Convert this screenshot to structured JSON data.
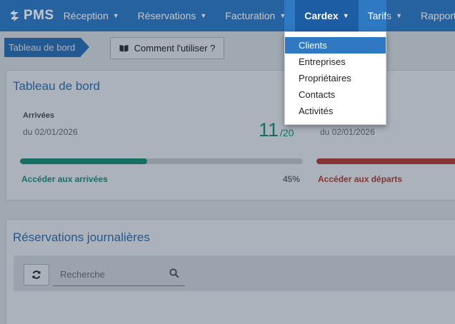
{
  "brand": {
    "name": "PMS"
  },
  "nav": {
    "items": [
      {
        "label": "Réception"
      },
      {
        "label": "Réservations"
      },
      {
        "label": "Facturation"
      },
      {
        "label": "Cardex"
      },
      {
        "label": "Tarifs"
      },
      {
        "label": "Rapports"
      }
    ],
    "active": "Cardex"
  },
  "dropdown": {
    "items": [
      {
        "label": "Clients"
      },
      {
        "label": "Entreprises"
      },
      {
        "label": "Propriétaires"
      },
      {
        "label": "Contacts"
      },
      {
        "label": "Activités"
      }
    ],
    "selected": "Clients"
  },
  "breadcrumb": {
    "label": "Tableau de bord"
  },
  "help_button": {
    "label": "Comment l'utiliser ?",
    "icon": "book-icon"
  },
  "dashboard": {
    "title": "Tableau de bord",
    "arrivals": {
      "label": "Arrivées",
      "date": "du 02/01/2026",
      "count": "11",
      "total": "/20",
      "progress": 0.45,
      "progress_text": "45%",
      "link": "Accéder aux arrivées",
      "color": "#1e9a7c"
    },
    "departures": {
      "date": "du 02/01/2026",
      "link": "Accéder aux départs",
      "color": "#c9402f"
    }
  },
  "reservations": {
    "title": "Réservations journalières",
    "refresh_icon": "refresh-icon",
    "search": {
      "placeholder": "Recherche",
      "value": "",
      "icon": "search-icon"
    }
  },
  "colors": {
    "primary": "#2f78c2",
    "primary_dark": "#1c5da3",
    "success": "#1e9a7c",
    "danger": "#c9402f"
  }
}
